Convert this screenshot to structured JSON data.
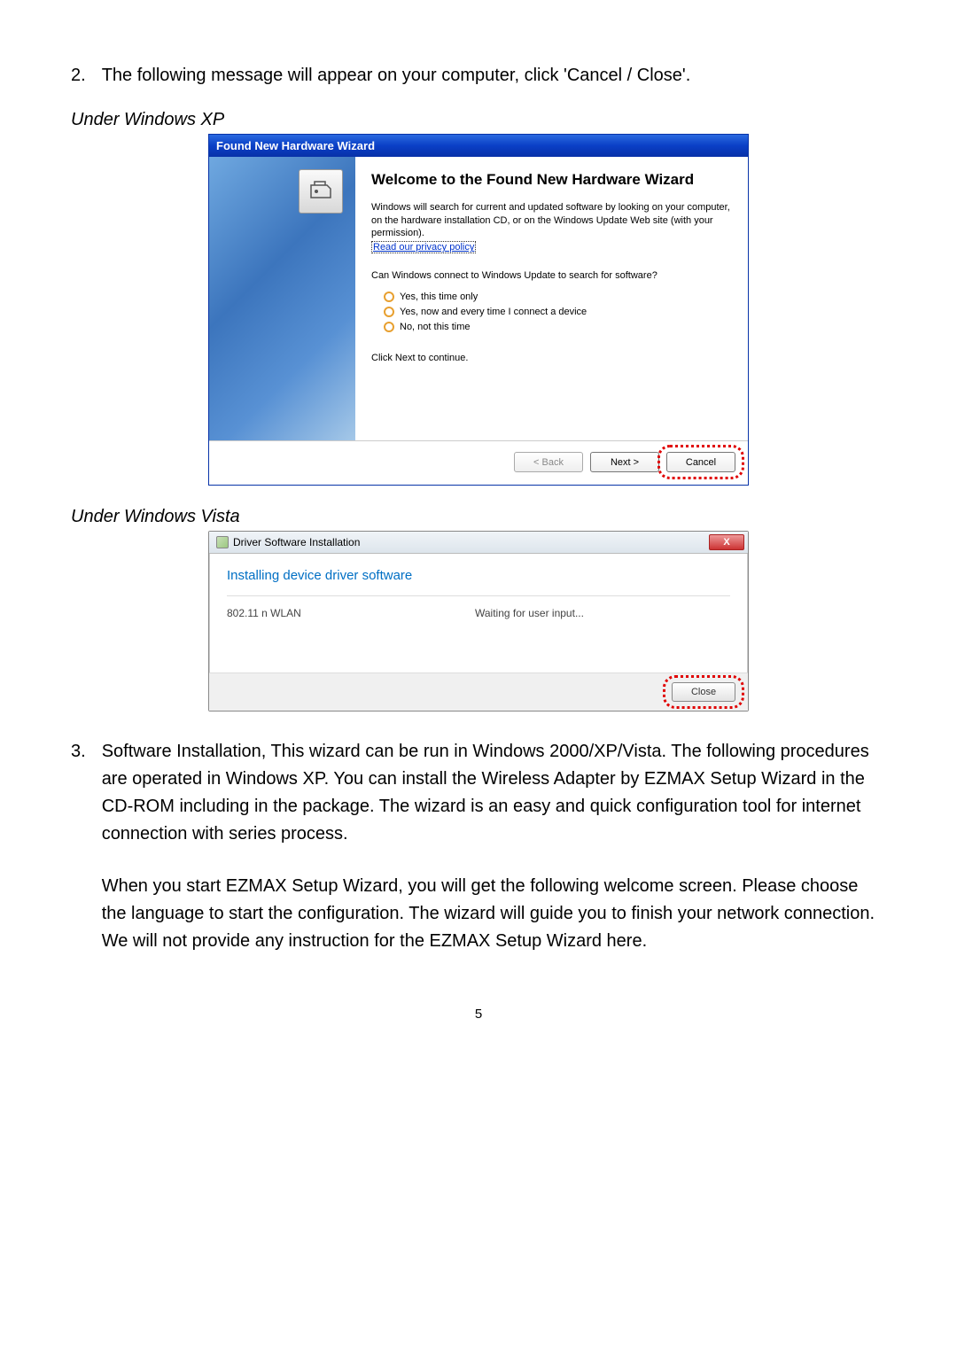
{
  "item2": {
    "num": "2.",
    "text": "The following message will appear on your computer, click 'Cancel / Close'."
  },
  "xp_label": "Under Windows XP",
  "xp_dialog": {
    "title": "Found New Hardware Wizard",
    "heading": "Welcome to the Found New Hardware Wizard",
    "para1": "Windows will search for current and updated software by looking on your computer, on the hardware installation CD, or on the Windows Update Web site (with your permission).",
    "link": "Read our privacy policy",
    "question": "Can Windows connect to Windows Update to search for software?",
    "radio1": "Yes, this time only",
    "radio2": "Yes, now and every time I connect a device",
    "radio3": "No, not this time",
    "continue": "Click Next to continue.",
    "back": "< Back",
    "next": "Next >",
    "cancel": "Cancel"
  },
  "vista_label": "Under Windows Vista",
  "vista_dialog": {
    "title": "Driver Software Installation",
    "heading": "Installing device driver software",
    "device": "802.11 n WLAN",
    "status": "Waiting for user input...",
    "close_x": "X",
    "close": "Close"
  },
  "item3": {
    "num": "3.",
    "para1": "Software Installation, This wizard can be run in Windows 2000/XP/Vista. The following procedures are operated in Windows XP. You can install the Wireless Adapter by EZMAX Setup Wizard in the CD-ROM including in the package. The wizard is an easy and quick configuration tool for internet connection with series process.",
    "para2": "When you start EZMAX Setup Wizard, you will get the following welcome screen. Please choose the language to start the configuration. The wizard will guide you to finish your network connection. We will not provide any instruction for the EZMAX Setup Wizard here."
  },
  "page_num": "5"
}
